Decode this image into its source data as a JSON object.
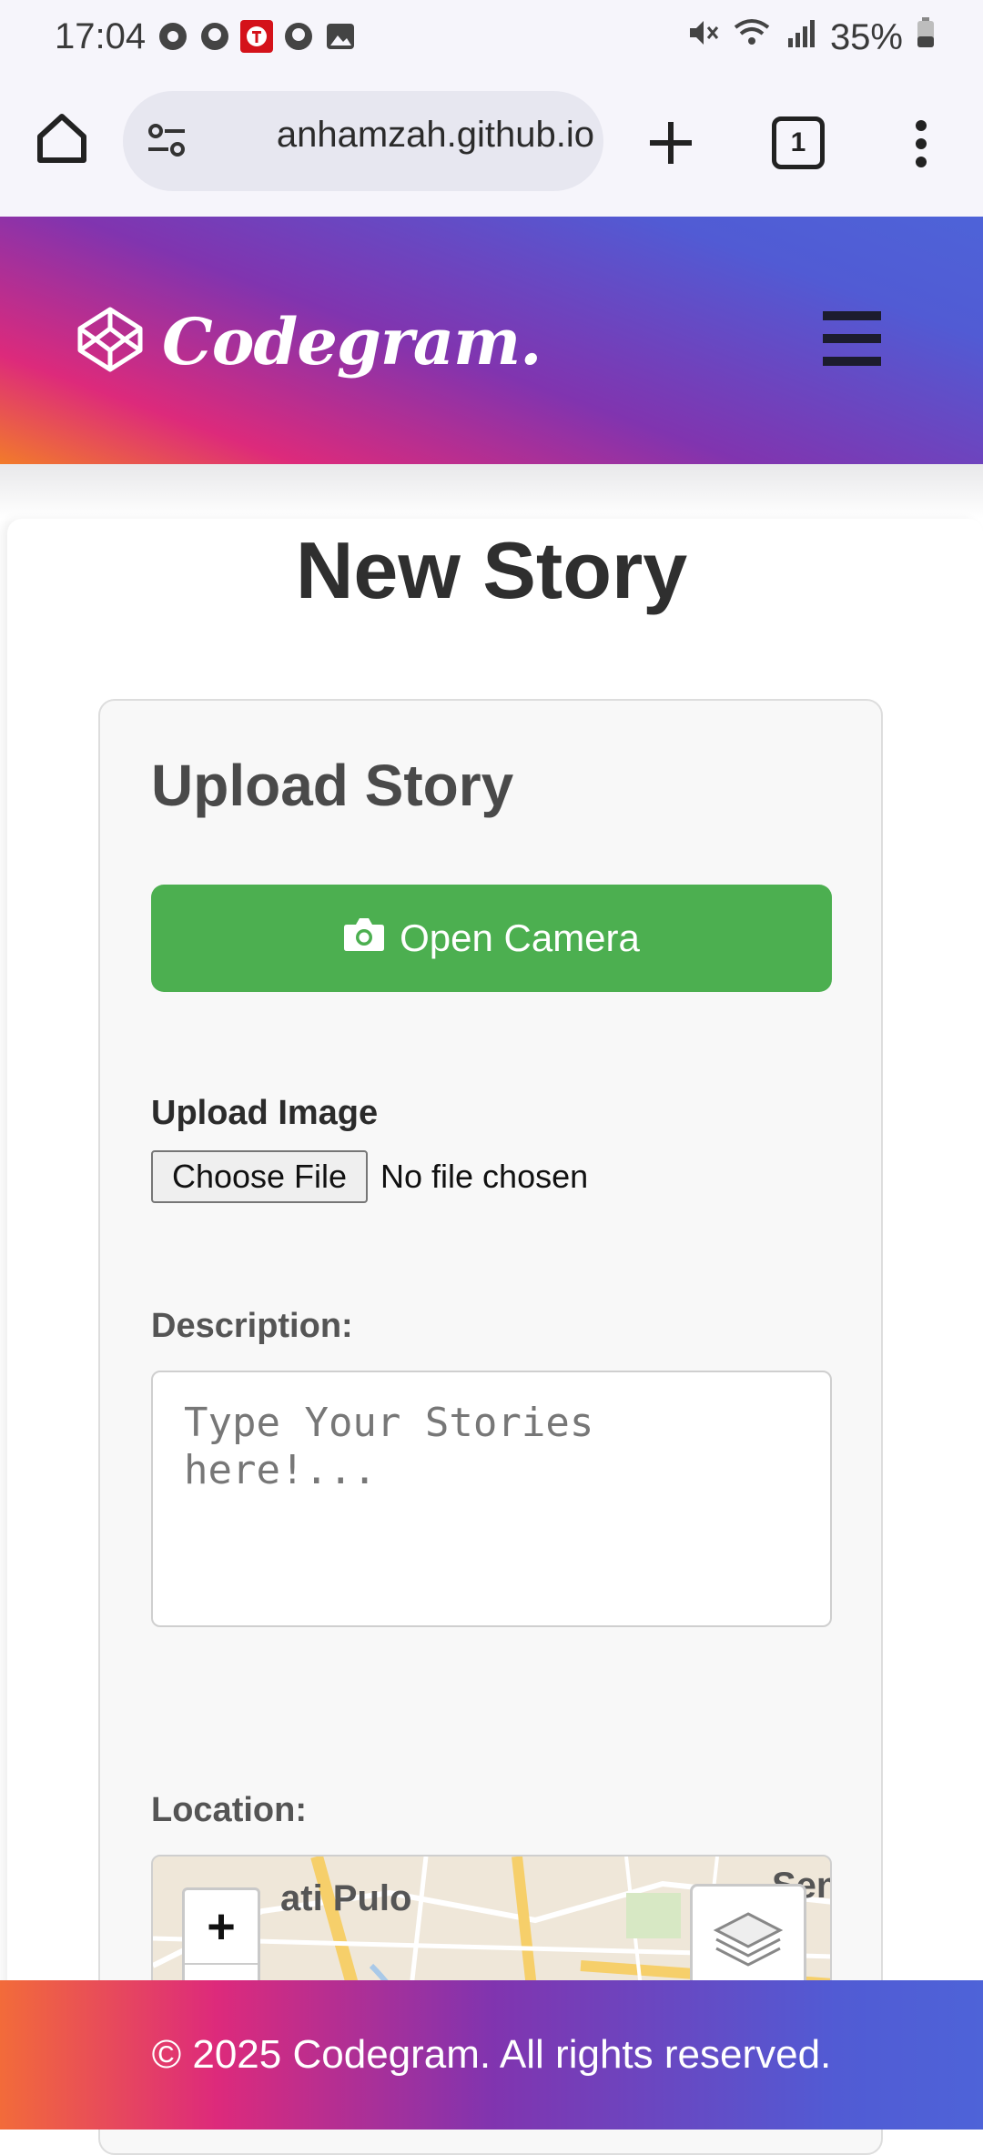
{
  "status_bar": {
    "time": "17:04",
    "battery": "35%",
    "left_icons": [
      "chrome-icon",
      "github-icon",
      "red-app-icon",
      "github-icon",
      "gallery-icon"
    ],
    "right_icons": [
      "mute-icon",
      "wifi-icon",
      "signal-icon",
      "battery-icon"
    ]
  },
  "browser": {
    "url": "anhamzah.github.io",
    "tab_count": "1"
  },
  "header": {
    "logo_text": "Codegram."
  },
  "page": {
    "title": "New Story"
  },
  "form": {
    "title": "Upload Story",
    "camera_button": "Open Camera",
    "upload_label": "Upload Image",
    "file_button": "Choose File",
    "file_status": "No file chosen",
    "description_label": "Description:",
    "description_placeholder": "Type Your Stories here!...",
    "location_label": "Location:"
  },
  "map": {
    "zoom_in": "+",
    "places": [
      "ati Pulo",
      "Sen"
    ]
  },
  "footer": {
    "text": "© 2025 Codegram. All rights reserved."
  },
  "colors": {
    "camera_button": "#4caf50",
    "gradient_start": "#f27b2a",
    "gradient_mid": "#8134af",
    "gradient_end": "#515bd4"
  }
}
